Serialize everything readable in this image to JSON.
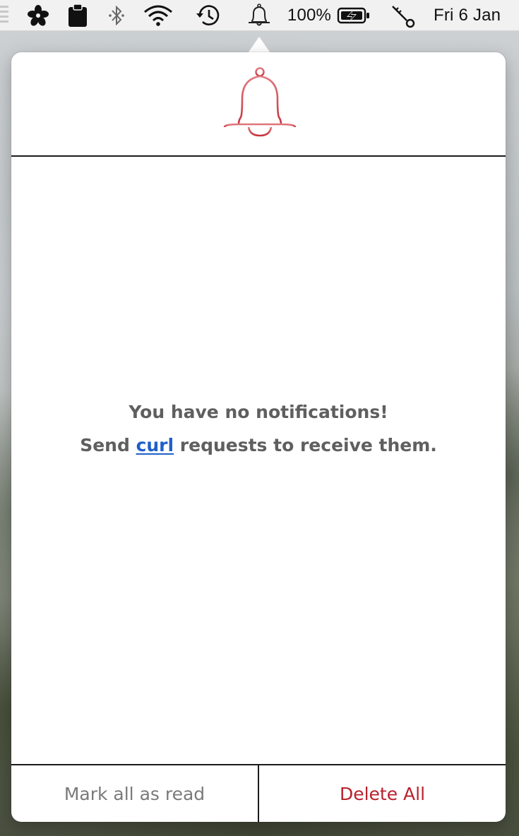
{
  "menubar": {
    "battery_percent": "100%",
    "clock": "Fri 6 Jan",
    "icons": [
      "flower-icon",
      "clipboard-icon",
      "bluetooth-icon",
      "wifi-icon",
      "time-machine-icon",
      "bell-icon",
      "battery-charging-icon",
      "key-icon"
    ]
  },
  "popover": {
    "header_icon": "bell-icon",
    "accent_color": "#cc3b44",
    "empty_line1": "You have no notifications!",
    "empty_line2_prefix": "Send ",
    "empty_line2_link": "curl",
    "empty_line2_suffix": " requests to receive them."
  },
  "footer": {
    "mark_all_label": "Mark all as read",
    "delete_all_label": "Delete All"
  }
}
